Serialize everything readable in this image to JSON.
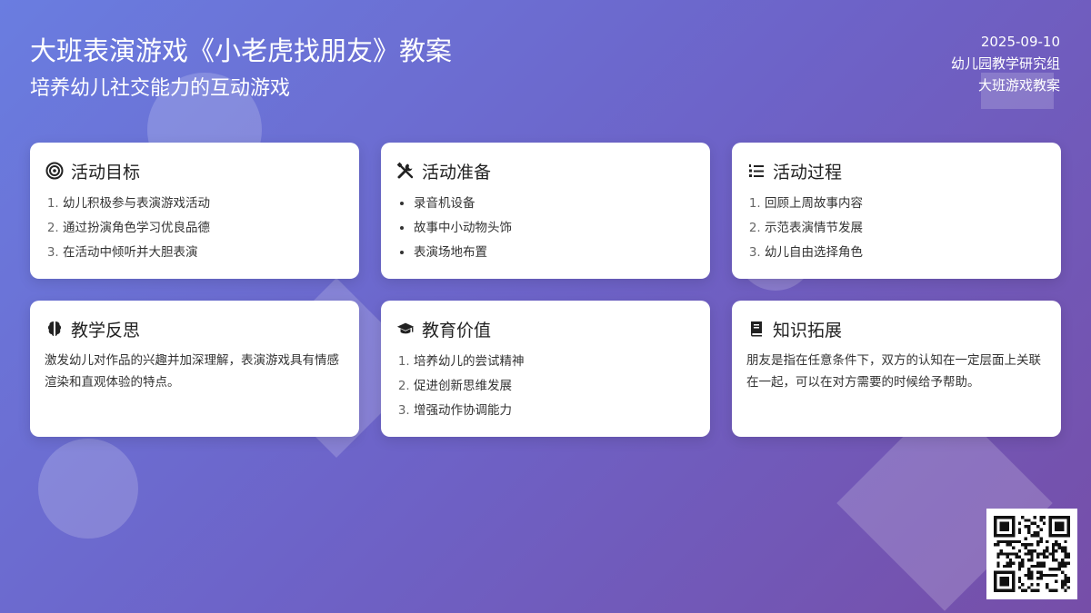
{
  "header": {
    "title": "大班表演游戏《小老虎找朋友》教案",
    "subtitle": "培养幼儿社交能力的互动游戏"
  },
  "meta": {
    "date": "2025-09-10",
    "org": "幼儿园教学研究组",
    "category": "大班游戏教案"
  },
  "cards": {
    "goals": {
      "title": "活动目标",
      "icon": "bullseye-icon",
      "items": [
        "幼儿积极参与表演游戏活动",
        "通过扮演角色学习优良品德",
        "在活动中倾听并大胆表演"
      ]
    },
    "prep": {
      "title": "活动准备",
      "icon": "tools-icon",
      "items": [
        "录音机设备",
        "故事中小动物头饰",
        "表演场地布置"
      ]
    },
    "process": {
      "title": "活动过程",
      "icon": "list-ol-icon",
      "items": [
        "回顾上周故事内容",
        "示范表演情节发展",
        "幼儿自由选择角色"
      ]
    },
    "reflection": {
      "title": "教学反思",
      "icon": "brain-icon",
      "text": "激发幼儿对作品的兴趣并加深理解，表演游戏具有情感渲染和直观体验的特点。"
    },
    "value": {
      "title": "教育价值",
      "icon": "graduation-cap-icon",
      "items": [
        "培养幼儿的尝试精神",
        "促进创新思维发展",
        "增强动作协调能力"
      ]
    },
    "knowledge": {
      "title": "知识拓展",
      "icon": "book-icon",
      "text": "朋友是指在任意条件下，双方的认知在一定层面上关联在一起，可以在对方需要的时候给予帮助。"
    }
  },
  "colors": {
    "accent": "#6a7de0",
    "card_bg": "#ffffff",
    "text": "#222222"
  }
}
